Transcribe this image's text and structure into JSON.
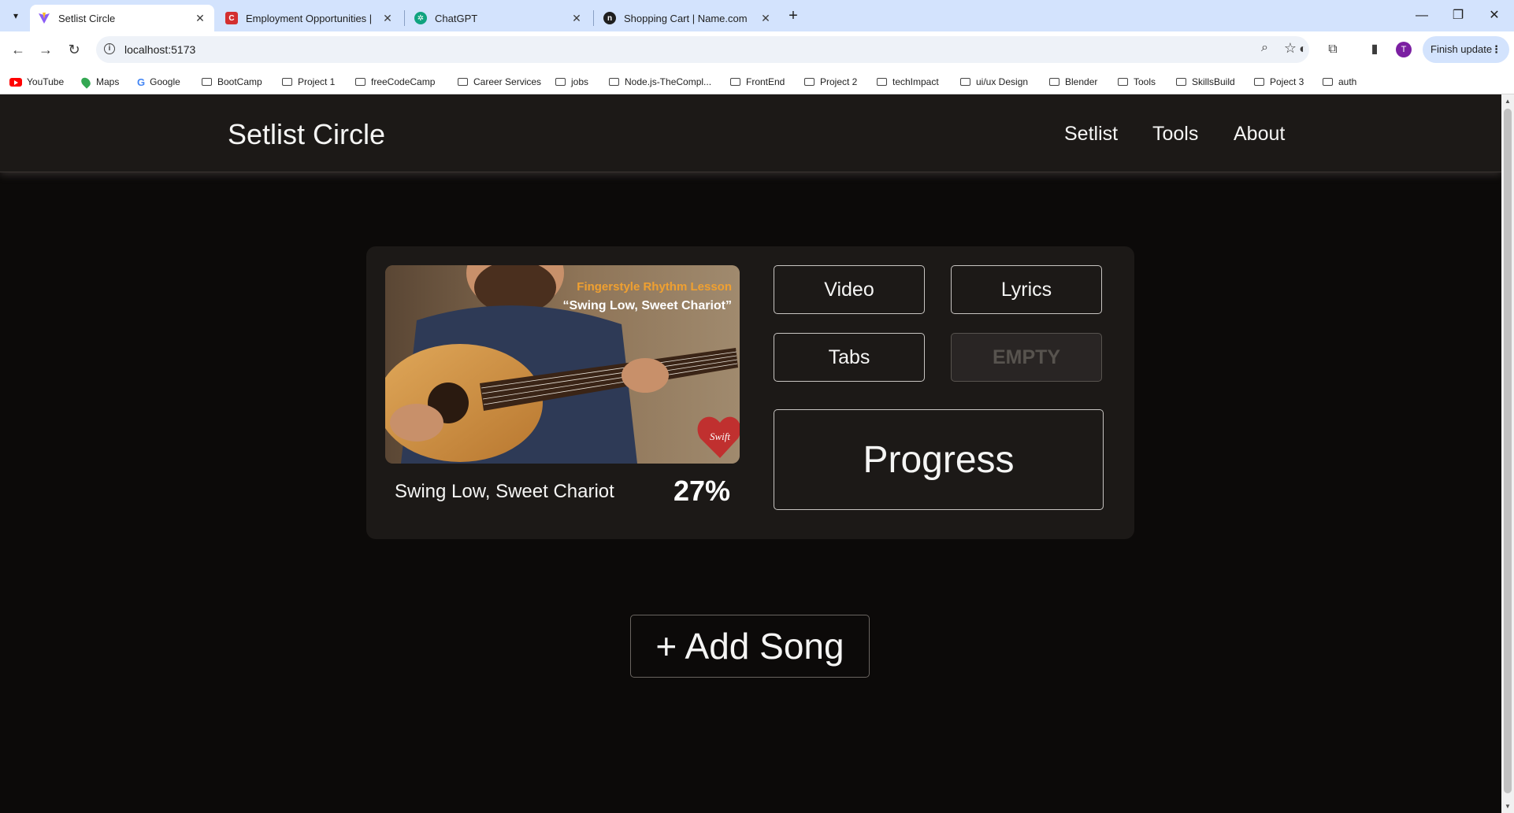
{
  "browser": {
    "tabs": [
      {
        "title": "Setlist Circle",
        "active": true,
        "favicon": "vite-icon",
        "color": "#8b5cf6"
      },
      {
        "title": "Employment Opportunities | Ci",
        "active": false,
        "favicon": "c-logo-icon",
        "color": "#d32f2f"
      },
      {
        "title": "ChatGPT",
        "active": false,
        "favicon": "chatgpt-icon",
        "color": "#10a37f"
      },
      {
        "title": "Shopping Cart | Name.com",
        "active": false,
        "favicon": "namecom-icon",
        "color": "#1f1f1f"
      }
    ],
    "url": "localhost:5173",
    "profile_initial": "T",
    "finish_update_label": "Finish update",
    "bookmarks": [
      {
        "label": "YouTube",
        "icon": "youtube-icon"
      },
      {
        "label": "Maps",
        "icon": "maps-icon"
      },
      {
        "label": "Google",
        "icon": "google-icon"
      },
      {
        "label": "BootCamp",
        "icon": "folder-icon"
      },
      {
        "label": "Project 1",
        "icon": "folder-icon"
      },
      {
        "label": "freeCodeCamp",
        "icon": "folder-icon"
      },
      {
        "label": "Career Services",
        "icon": "folder-icon"
      },
      {
        "label": "jobs",
        "icon": "folder-icon"
      },
      {
        "label": "Node.js-TheCompl...",
        "icon": "folder-icon"
      },
      {
        "label": "FrontEnd",
        "icon": "folder-icon"
      },
      {
        "label": "Project 2",
        "icon": "folder-icon"
      },
      {
        "label": "techImpact",
        "icon": "folder-icon"
      },
      {
        "label": "ui/ux Design",
        "icon": "folder-icon"
      },
      {
        "label": "Blender",
        "icon": "folder-icon"
      },
      {
        "label": "Tools",
        "icon": "folder-icon"
      },
      {
        "label": "SkillsBuild",
        "icon": "folder-icon"
      },
      {
        "label": "Poject 3",
        "icon": "folder-icon"
      },
      {
        "label": "auth",
        "icon": "folder-icon"
      }
    ]
  },
  "site": {
    "brand": "Setlist Circle",
    "nav": [
      "Setlist",
      "Tools",
      "About"
    ]
  },
  "song_card": {
    "thumbnail": {
      "line1": "Fingerstyle Rhythm Lesson",
      "line2": "“Swing Low, Sweet Chariot”",
      "badge": "Swift"
    },
    "title": "Swing Low, Sweet Chariot",
    "progress": "27%",
    "buttons": {
      "video": "Video",
      "lyrics": "Lyrics",
      "tabs": "Tabs",
      "empty": "EMPTY",
      "progress": "Progress"
    }
  },
  "add_song_label": "+ Add Song",
  "colors": {
    "page_bg": "#0c0a09",
    "header_bg": "#1c1917",
    "card_bg": "#1c1917",
    "text": "#f5f5f4",
    "muted": "#57534e"
  }
}
